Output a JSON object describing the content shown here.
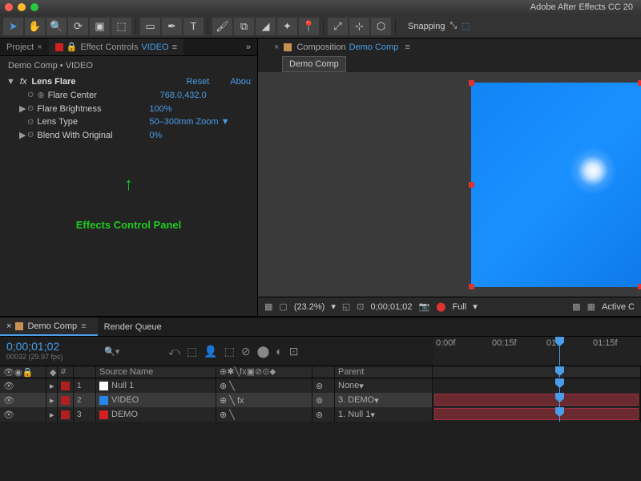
{
  "window": {
    "title": "Adobe After Effects CC 20"
  },
  "toolbar": {
    "snapping_label": "Snapping"
  },
  "panels": {
    "project_tab": "Project",
    "effect_controls_tab": "Effect Controls",
    "effect_controls_item": "VIDEO",
    "breadcrumb_comp": "Demo Comp",
    "breadcrumb_layer": "VIDEO",
    "composition_tab": "Composition",
    "composition_item": "Demo Comp",
    "nested_tab": "Demo Comp"
  },
  "effect": {
    "name": "Lens Flare",
    "reset": "Reset",
    "about": "Abou",
    "props": [
      {
        "name": "Flare Center",
        "value": "768.0,432.0",
        "expand": "",
        "crosshair": true
      },
      {
        "name": "Flare Brightness",
        "value": "100%",
        "expand": "▶"
      },
      {
        "name": "Lens Type",
        "value": "50–300mm Zoom ▼",
        "expand": ""
      },
      {
        "name": "Blend With Original",
        "value": "0%",
        "expand": "▶"
      }
    ]
  },
  "annotation": {
    "text": "Effects Control Panel"
  },
  "viewer_bar": {
    "zoom": "(23.2%)",
    "timecode": "0;00;01;02",
    "resolution": "Full",
    "view": "Active C"
  },
  "timeline": {
    "tabs": [
      "Demo Comp",
      "Render Queue"
    ],
    "timecode": "0;00;01;02",
    "frames": "00032 (29.97 fps)",
    "ruler": [
      "0:00f",
      "00:15f",
      "01:",
      "01:15f"
    ],
    "columns": {
      "num": "#",
      "source": "Source Name",
      "parent": "Parent"
    },
    "layers": [
      {
        "num": "1",
        "name": "Null 1",
        "parent": "None",
        "color": "#ffffff"
      },
      {
        "num": "2",
        "name": "VIDEO",
        "parent": "3. DEMO",
        "color": "#2585e8",
        "sel": true,
        "fx": true
      },
      {
        "num": "3",
        "name": "DEMO",
        "parent": "1. Null 1",
        "color": "#d02020"
      }
    ]
  }
}
